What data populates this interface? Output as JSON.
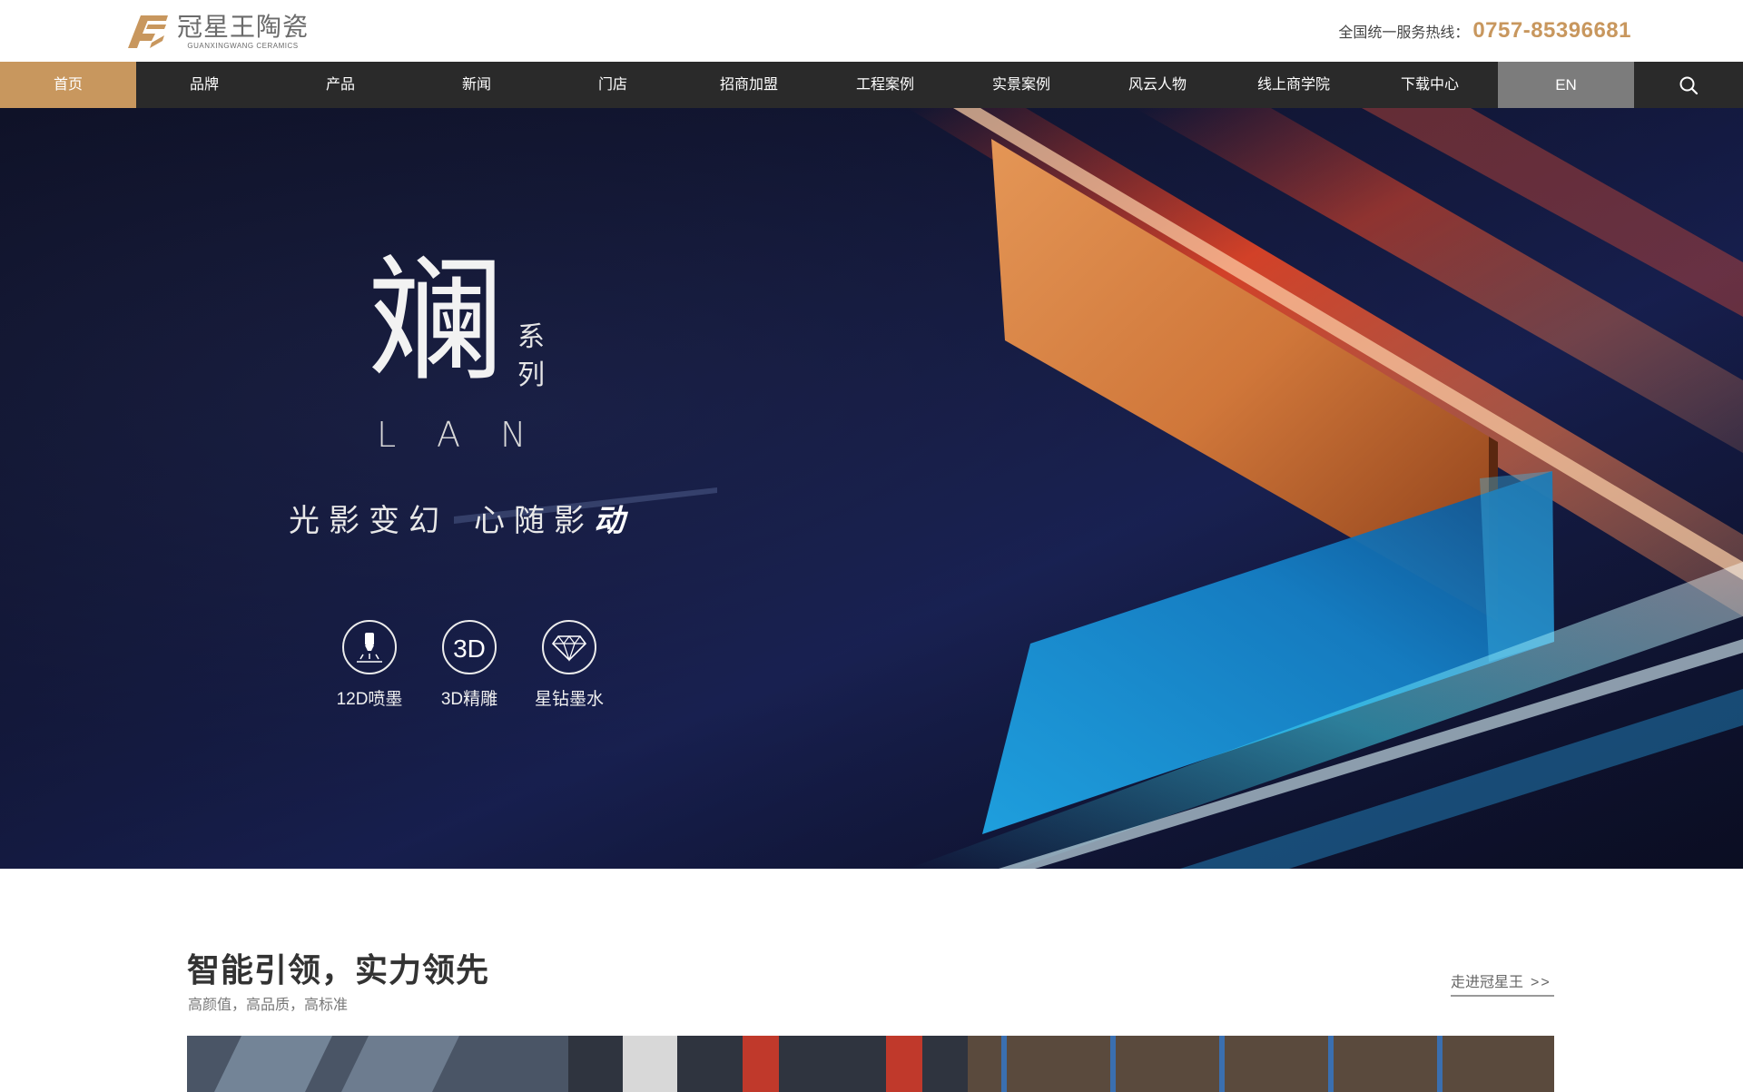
{
  "header": {
    "logo": {
      "name_cn": "冠星王陶瓷",
      "name_en": "GUANXINGWANG CERAMICS",
      "icon": "star-logo-icon"
    },
    "hotline": {
      "label": "全国统一服务热线：",
      "number": "0757-85396681"
    }
  },
  "nav": {
    "items": [
      {
        "label": "首页",
        "active": true
      },
      {
        "label": "品牌"
      },
      {
        "label": "产品"
      },
      {
        "label": "新闻"
      },
      {
        "label": "门店"
      },
      {
        "label": "招商加盟"
      },
      {
        "label": "工程案例"
      },
      {
        "label": "实景案例"
      },
      {
        "label": "风云人物"
      },
      {
        "label": "线上商学院"
      },
      {
        "label": "下载中心"
      }
    ],
    "language": "EN",
    "search_icon": "search-icon"
  },
  "banner": {
    "series_char": "斓",
    "series_label": "系列",
    "series_en": "LAN",
    "slogan_part1": "光影变幻",
    "slogan_part2": "心随影",
    "slogan_emph": "动",
    "features": [
      {
        "label": "12D喷墨",
        "icon": "inkjet-nozzle-icon"
      },
      {
        "label": "3D精雕",
        "icon": "3d-icon"
      },
      {
        "label": "星钻墨水",
        "icon": "diamond-icon"
      }
    ]
  },
  "section": {
    "title": "智能引领，实力领先",
    "subtitle": "高颜值，高品质，高标准",
    "more_link": "走进冠星王",
    "more_arrow": ">>"
  },
  "colors": {
    "accent": "#c8975e",
    "nav_bg": "#2a2a2a",
    "lang_bg": "#7c7c7c",
    "banner_bg": "#0f1228"
  }
}
